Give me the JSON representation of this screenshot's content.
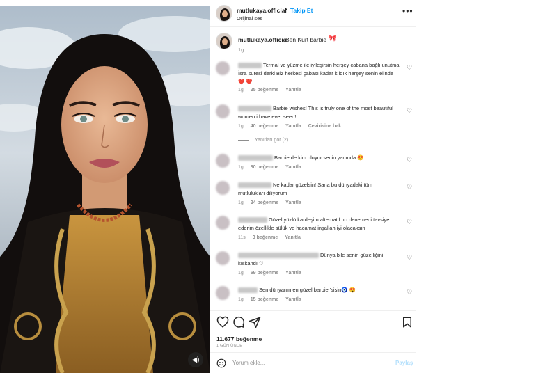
{
  "post": {
    "username": "mutlukaya.official",
    "separator": "•",
    "follow_label": "Takip Et",
    "audio_label": "Orijinal ses",
    "more_label": "•••",
    "caption_text": "Ben Kürt barbie",
    "caption_emoji": "🎀",
    "caption_time": "1g"
  },
  "comments": [
    {
      "text": "Termal ve yüzme ile iyileşirsin herşey cabana bağlı unutma İsra suresi derki Biz herkesi çabası kadar kıldık herşey senin elinde ❤️ ❤️",
      "time": "1g",
      "likes": "25 beğenme",
      "reply": "Yanıtla",
      "translate": ""
    },
    {
      "text": "Barbie wishes! This is truly one of the most beautiful women i have ever seen!",
      "time": "1g",
      "likes": "40 beğenme",
      "reply": "Yanıtla",
      "translate": "Çevirisine bak"
    },
    {
      "text": "Barbie de kim oluyor senin yanında 😍",
      "time": "1g",
      "likes": "80 beğenme",
      "reply": "Yanıtla",
      "translate": ""
    },
    {
      "text": "Ne kadar güzelsin! Sana bu dünyadaki tüm mutlulukları diliyorum",
      "time": "1g",
      "likes": "24 beğenme",
      "reply": "Yanıtla",
      "translate": ""
    },
    {
      "text": "Güzel yüzlü kardeşim alternatif tıp denemeni tavsiye ederim özellikle sülük ve hacamat inşallah iyi olacaksın",
      "time": "11s",
      "likes": "3 beğenme",
      "reply": "Yanıtla",
      "translate": ""
    },
    {
      "text": "Dünya bile senin güzelliğini kıskandı ♡",
      "time": "1g",
      "likes": "69 beğenme",
      "reply": "Yanıtla",
      "translate": ""
    },
    {
      "text": "Sen dünyanın en güzel barbie 'sisin🧿 😍",
      "time": "1g",
      "likes": "15 beğenme",
      "reply": "Yanıtla",
      "translate": ""
    }
  ],
  "view_replies_label": "Yanıtları gör (2)",
  "like_count": "11.677 beğenme",
  "posted_ago": "1 GÜN ÖNCE",
  "add_comment": {
    "placeholder": "Yorum ekle...",
    "send_label": "Paylaş"
  },
  "icons": {
    "heart": "heart-icon",
    "comment": "comment-icon",
    "share": "share-icon",
    "save": "bookmark-icon",
    "emoji": "emoji-icon",
    "mute": "speaker-icon"
  },
  "colors": {
    "link_blue": "#0095f6",
    "muted_text": "#8e8e8e",
    "send_disabled": "#b2dffc"
  }
}
